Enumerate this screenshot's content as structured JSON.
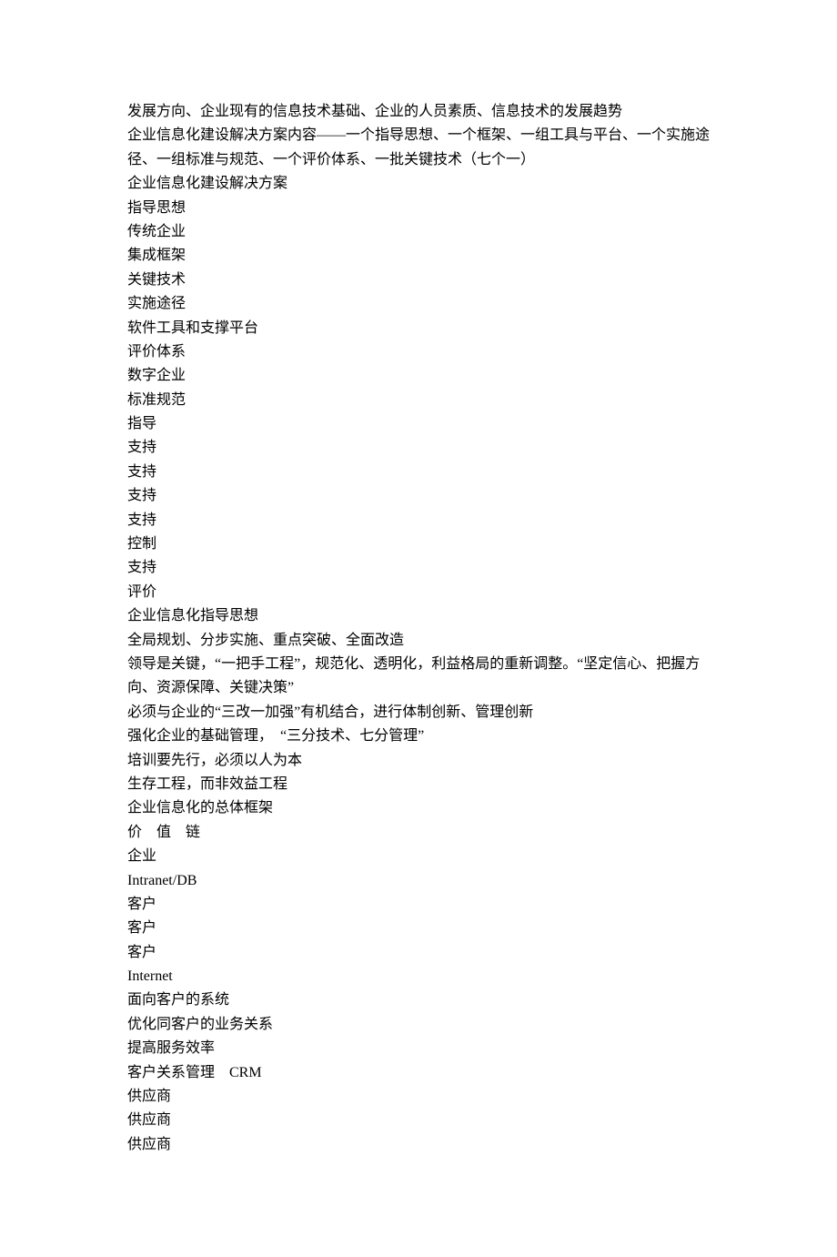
{
  "lines": [
    "发展方向、企业现有的信息技术基础、企业的人员素质、信息技术的发展趋势",
    "企业信息化建设解决方案内容——一个指导思想、一个框架、一组工具与平台、一个实施途径、一组标准与规范、一个评价体系、一批关键技术（七个一）",
    "企业信息化建设解决方案",
    "指导思想",
    "传统企业",
    "集成框架",
    "关键技术",
    "实施途径",
    "软件工具和支撑平台",
    "评价体系",
    "数字企业",
    "标准规范",
    "指导",
    "支持",
    "支持",
    "支持",
    "支持",
    "控制",
    "支持",
    "评价",
    "企业信息化指导思想",
    "全局规划、分步实施、重点突破、全面改造",
    "领导是关键，“一把手工程”，规范化、透明化，利益格局的重新调整。“坚定信心、把握方向、资源保障、关键决策”",
    "必须与企业的“三改一加强”有机结合，进行体制创新、管理创新",
    "强化企业的基础管理，　“三分技术、七分管理”",
    "培训要先行，必须以人为本",
    "生存工程，而非效益工程",
    "企业信息化的总体框架",
    "价　值　链",
    "企业",
    "Intranet/DB",
    "客户",
    "客户",
    "客户",
    "Internet",
    "面向客户的系统",
    "优化同客户的业务关系",
    "提高服务效率",
    "客户关系管理　CRM",
    "供应商",
    "供应商",
    "供应商"
  ]
}
